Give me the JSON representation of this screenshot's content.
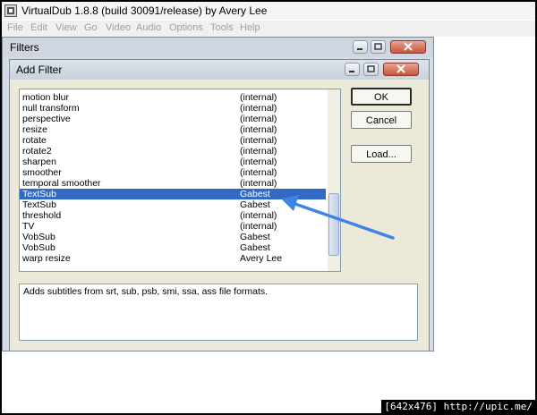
{
  "app": {
    "title": "VirtualDub 1.8.8 (build 30091/release) by Avery Lee",
    "menu": [
      "File",
      "Edit",
      "View",
      "Go",
      "Video",
      "Audio",
      "Options",
      "Tools",
      "Help"
    ]
  },
  "filters_window": {
    "title": "Filters"
  },
  "add_filter": {
    "title": "Add Filter",
    "rows": [
      {
        "name": "motion blur",
        "author": "(internal)"
      },
      {
        "name": "null transform",
        "author": "(internal)"
      },
      {
        "name": "perspective",
        "author": "(internal)"
      },
      {
        "name": "resize",
        "author": "(internal)"
      },
      {
        "name": "rotate",
        "author": "(internal)"
      },
      {
        "name": "rotate2",
        "author": "(internal)"
      },
      {
        "name": "sharpen",
        "author": "(internal)"
      },
      {
        "name": "smoother",
        "author": "(internal)"
      },
      {
        "name": "temporal smoother",
        "author": "(internal)"
      },
      {
        "name": "TextSub",
        "author": "Gabest",
        "selected": true
      },
      {
        "name": "TextSub",
        "author": "Gabest"
      },
      {
        "name": "threshold",
        "author": "(internal)"
      },
      {
        "name": "TV",
        "author": "(internal)"
      },
      {
        "name": "VobSub",
        "author": "Gabest"
      },
      {
        "name": "VobSub",
        "author": "Gabest"
      },
      {
        "name": "warp resize",
        "author": "Avery Lee"
      }
    ],
    "description": "Adds subtitles from srt, sub, psb, smi, ssa, ass file formats.",
    "buttons": {
      "ok": "OK",
      "cancel": "Cancel",
      "load": "Load..."
    }
  },
  "watermark": "[642x476] http://upic.me/",
  "colors": {
    "selection": "#316ac5",
    "arrow": "#3f84e5",
    "close_button": "#c8543c"
  }
}
